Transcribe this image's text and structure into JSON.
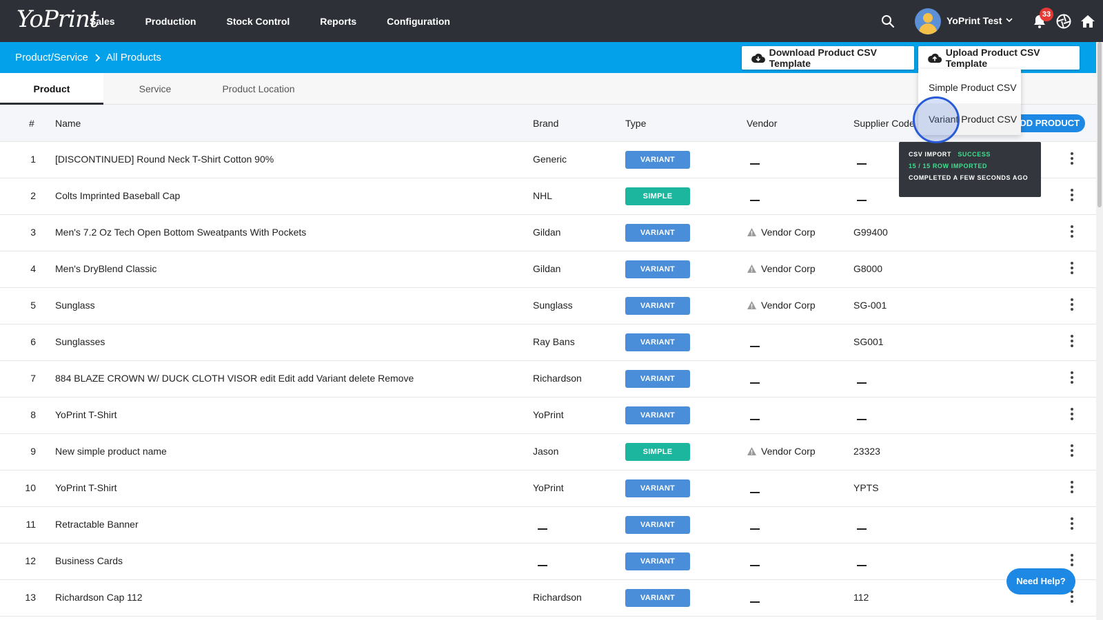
{
  "app": {
    "logo": "YoPrint"
  },
  "nav": [
    "Sales",
    "Production",
    "Stock Control",
    "Reports",
    "Configuration"
  ],
  "user": {
    "name": "YoPrint Test",
    "notifications": "33"
  },
  "breadcrumb": {
    "parent": "Product/Service",
    "current": "All Products"
  },
  "actions": {
    "download": "Download Product CSV Template",
    "upload": "Upload Product CSV Template",
    "add_product": "ADD PRODUCT"
  },
  "upload_menu": [
    "Simple Product CSV",
    "Variant Product CSV"
  ],
  "toast": {
    "label": "CSV IMPORT",
    "status": "SUCCESS",
    "rows": "15 / 15 ROW IMPORTED",
    "time": "COMPLETED A FEW SECONDS AGO"
  },
  "tabs": [
    "Product",
    "Service",
    "Product Location"
  ],
  "columns": {
    "num": "#",
    "name": "Name",
    "brand": "Brand",
    "type": "Type",
    "vendor": "Vendor",
    "supplier": "Supplier Code"
  },
  "rows": [
    {
      "num": "1",
      "name": "[DISCONTINUED] Round Neck T-Shirt Cotton 90%",
      "brand": "Generic",
      "type": "VARIANT",
      "vendor": "",
      "supplier": ""
    },
    {
      "num": "2",
      "name": "Colts Imprinted Baseball Cap",
      "brand": "NHL",
      "type": "SIMPLE",
      "vendor": "",
      "supplier": ""
    },
    {
      "num": "3",
      "name": "Men's 7.2 Oz Tech Open Bottom Sweatpants With Pockets",
      "brand": "Gildan",
      "type": "VARIANT",
      "vendor": "Vendor Corp",
      "supplier": "G99400"
    },
    {
      "num": "4",
      "name": "Men's DryBlend Classic",
      "brand": "Gildan",
      "type": "VARIANT",
      "vendor": "Vendor Corp",
      "supplier": "G8000"
    },
    {
      "num": "5",
      "name": "Sunglass",
      "brand": "Sunglass",
      "type": "VARIANT",
      "vendor": "Vendor Corp",
      "supplier": "SG-001"
    },
    {
      "num": "6",
      "name": "Sunglasses",
      "brand": "Ray Bans",
      "type": "VARIANT",
      "vendor": "",
      "supplier": "SG001"
    },
    {
      "num": "7",
      "name": "884 BLAZE CROWN W/ DUCK CLOTH VISOR edit Edit add Variant delete Remove",
      "brand": "Richardson",
      "type": "VARIANT",
      "vendor": "",
      "supplier": ""
    },
    {
      "num": "8",
      "name": "YoPrint T-Shirt",
      "brand": "YoPrint",
      "type": "VARIANT",
      "vendor": "",
      "supplier": ""
    },
    {
      "num": "9",
      "name": "New simple product name",
      "brand": "Jason",
      "type": "SIMPLE",
      "vendor": "Vendor Corp",
      "supplier": "23323"
    },
    {
      "num": "10",
      "name": "YoPrint T-Shirt",
      "brand": "YoPrint",
      "type": "VARIANT",
      "vendor": "",
      "supplier": "YPTS"
    },
    {
      "num": "11",
      "name": "Retractable Banner",
      "brand": "",
      "type": "VARIANT",
      "vendor": "",
      "supplier": ""
    },
    {
      "num": "12",
      "name": "Business Cards",
      "brand": "",
      "type": "VARIANT",
      "vendor": "",
      "supplier": ""
    },
    {
      "num": "13",
      "name": "Richardson Cap 112",
      "brand": "Richardson",
      "type": "VARIANT",
      "vendor": "",
      "supplier": "112"
    }
  ],
  "help": "Need Help?",
  "colors": {
    "topbar": "#2d3037",
    "bluebar": "#03a1e9",
    "variant": "#4a8dd8",
    "simple": "#1bb69d",
    "accent": "#1e88e5"
  },
  "icons": [
    "search-icon",
    "chevron-down-icon",
    "bell-icon",
    "aperture-icon",
    "home-icon",
    "cloud-download-icon",
    "cloud-upload-icon",
    "warning-icon",
    "kebab-icon"
  ]
}
